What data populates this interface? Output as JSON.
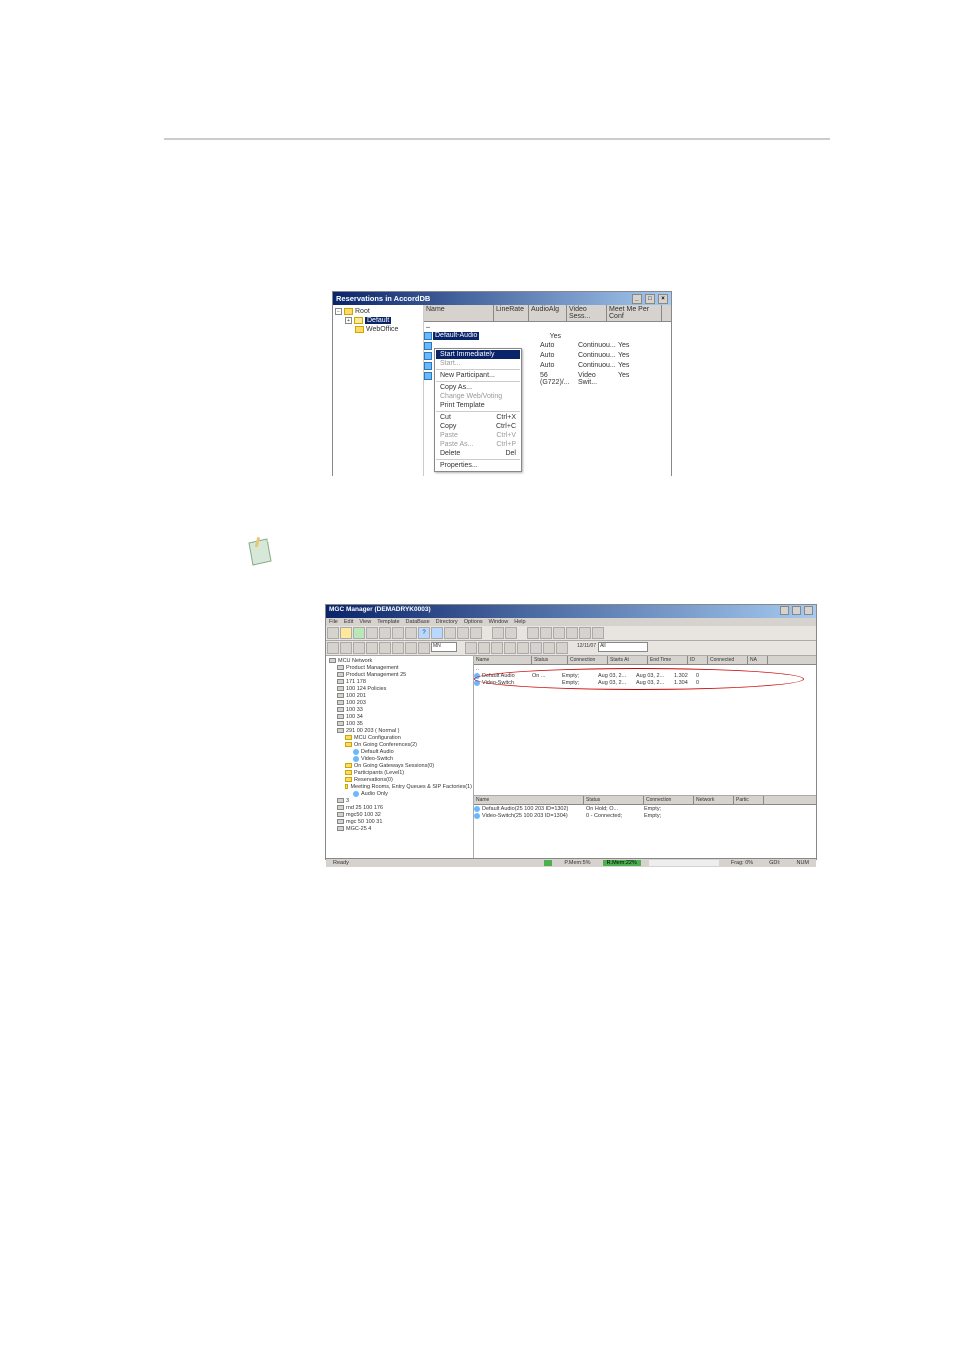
{
  "window1": {
    "title": "Reservations in AccordDB",
    "tree": {
      "root": "Root",
      "folders": [
        "Default",
        "WebOffice"
      ]
    },
    "columns": [
      "Name",
      "LineRate",
      "AudioAlg",
      "Video Sess...",
      "Meet Me Per Conf"
    ],
    "up_label": "..",
    "selected": "Default-Audio",
    "rows": [
      {
        "name": "",
        "line": "",
        "audio": "",
        "video": "",
        "meet": "Yes"
      },
      {
        "name": "",
        "line": "",
        "audio": "Auto",
        "video": "Continuou...",
        "meet": "Yes"
      },
      {
        "name": "",
        "line": "",
        "audio": "Auto",
        "video": "Continuou...",
        "meet": "Yes"
      },
      {
        "name": "",
        "line": "",
        "audio": "Auto",
        "video": "Continuou...",
        "meet": "Yes"
      },
      {
        "name": "",
        "line": "",
        "audio": "56 (G722)/...",
        "video": "Video Swit...",
        "meet": "Yes"
      }
    ],
    "context_menu": {
      "items": [
        {
          "label": "Start Immediately",
          "shortcut": "",
          "hover": true
        },
        {
          "label": "Start...",
          "shortcut": "",
          "disabled": true
        },
        {
          "label": "New Participant...",
          "shortcut": ""
        },
        {
          "label": "Copy As...",
          "shortcut": ""
        },
        {
          "label": "Change Web/Voting",
          "shortcut": "",
          "disabled": true
        },
        {
          "label": "Print Template",
          "shortcut": ""
        },
        {
          "label": "Cut",
          "shortcut": "Ctrl+X"
        },
        {
          "label": "Copy",
          "shortcut": "Ctrl+C"
        },
        {
          "label": "Paste",
          "shortcut": "Ctrl+V",
          "disabled": true
        },
        {
          "label": "Paste As...",
          "shortcut": "Ctrl+P",
          "disabled": true
        },
        {
          "label": "Delete",
          "shortcut": "Del"
        },
        {
          "label": "Properties...",
          "shortcut": ""
        }
      ]
    }
  },
  "window2": {
    "title": "MGC Manager (DEMADRYK0003)",
    "menubar": [
      "File",
      "Edit",
      "View",
      "Template",
      "DataBase",
      "Directory",
      "Options",
      "Window",
      "Help"
    ],
    "mname_value": "MN",
    "filter_value": "All",
    "date_value": "12/11/07",
    "tree": [
      {
        "l": 0,
        "label": "MCU Network"
      },
      {
        "l": 1,
        "label": "Product Management"
      },
      {
        "l": 1,
        "label": "Product Management 25"
      },
      {
        "l": 1,
        "label": "171 178"
      },
      {
        "l": 1,
        "label": "100 124 Policies"
      },
      {
        "l": 1,
        "label": "100 201"
      },
      {
        "l": 1,
        "label": "100 203"
      },
      {
        "l": 1,
        "label": "100 33"
      },
      {
        "l": 1,
        "label": "100 34"
      },
      {
        "l": 1,
        "label": "100 35"
      },
      {
        "l": 1,
        "label": "291 00 203  ( Normal )"
      },
      {
        "l": 2,
        "label": "MCU Configuration"
      },
      {
        "l": 2,
        "label": "On Going Conferences(2)",
        "sel": true
      },
      {
        "l": 3,
        "label": "Default Audio"
      },
      {
        "l": 3,
        "label": "Video-Switch"
      },
      {
        "l": 2,
        "label": "On Going Gateways Sessions(0)"
      },
      {
        "l": 2,
        "label": "Participants (Level1)"
      },
      {
        "l": 2,
        "label": "Reservations(0)"
      },
      {
        "l": 2,
        "label": "Meeting Rooms, Entry Queues & SIP Factories(1)"
      },
      {
        "l": 3,
        "label": "Audio Only"
      },
      {
        "l": 1,
        "label": "3"
      },
      {
        "l": 1,
        "label": "rnd 25 100 176"
      },
      {
        "l": 1,
        "label": "mgc50 100 32"
      },
      {
        "l": 1,
        "label": "mgc 50 100 31"
      },
      {
        "l": 1,
        "label": "MGC-25 4"
      }
    ],
    "top_grid": {
      "columns": [
        "Name",
        "Status",
        "Connection",
        "Starts At",
        "End Time",
        "ID",
        "Connected",
        "NA"
      ],
      "up_label": "..",
      "rows": [
        {
          "name": "Default Audio",
          "status": "On ...",
          "conn": "Empty;",
          "start": "Aug 03, 2...",
          "end": "Aug 03, 2...",
          "id": "1.302",
          "connected": "0"
        },
        {
          "name": "Video-Switch",
          "status": "",
          "conn": "Empty;",
          "start": "Aug 03, 2...",
          "end": "Aug 03, 2...",
          "id": "1.304",
          "connected": "0"
        }
      ]
    },
    "bottom_grid": {
      "columns": [
        "Name",
        "Status",
        "Connection",
        "Network",
        "Partic"
      ],
      "rows": [
        {
          "name": "Default Audio(25 100 203 ID=1302)",
          "status": "On Hold; O...",
          "conn": "Empty;"
        },
        {
          "name": "Video-Switch(25 100 203 ID=1304)",
          "status": "0 - Connected;",
          "conn": "Empty;"
        }
      ]
    },
    "statusbar": {
      "ready": "Ready",
      "pmem": "P.Mem:5%",
      "rmem": "R.Mem:22%",
      "frag": "Frag: 0%",
      "gdi": "GDI:",
      "num": "NUM"
    }
  }
}
